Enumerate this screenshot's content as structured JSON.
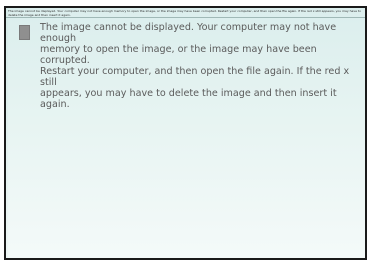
{
  "header": {
    "text": "The image cannot be displayed. Your computer may not have enough memory to open the image, or the image may have been corrupted. Restart your computer, and then open the file again. If the red x still appears, you may have to delete the image and then insert it again."
  },
  "placeholder": {
    "icon": "broken-image-icon",
    "message": "The image cannot be displayed. Your computer may not have enough\nmemory to open the image, or the image may have been corrupted.\nRestart your computer, and then open the file again. If the red x still\nappears, you may have to delete the image and then insert it again."
  },
  "colors": {
    "border": "#1a1a1a",
    "background_top": "#dbeeed",
    "background_bottom": "#f4faf9",
    "text": "#5b5b5b",
    "icon": "#8f8f8f"
  }
}
